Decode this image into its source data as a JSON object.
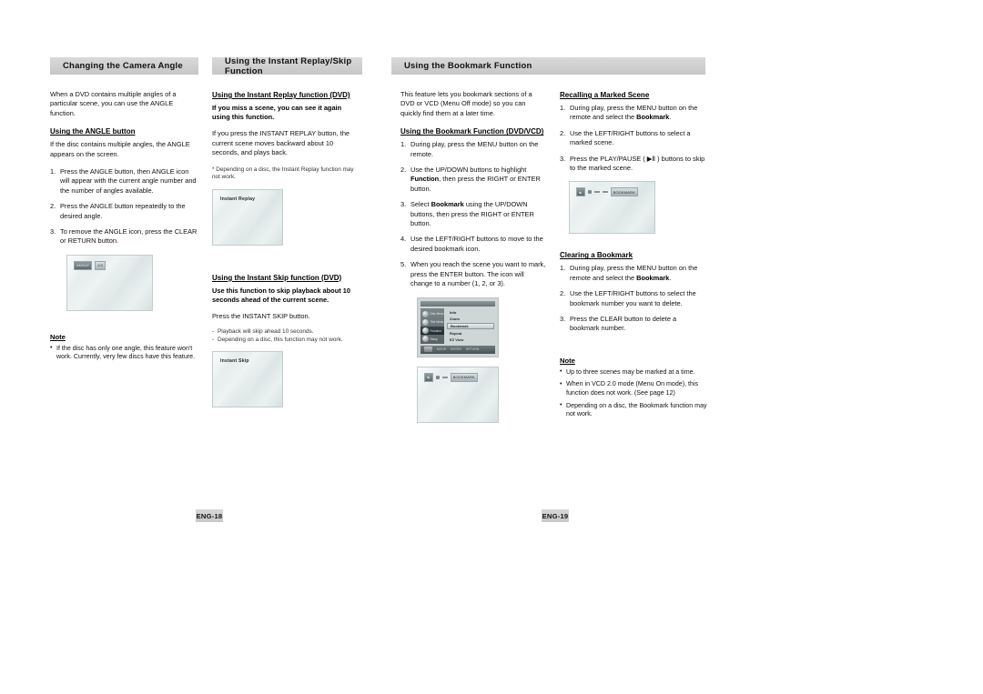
{
  "document": {
    "kind": "dvd-player-user-manual-spread",
    "left_page_number": "ENG-18",
    "right_page_number": "ENG-19"
  },
  "headers": {
    "camera_angle": "Changing the Camera Angle",
    "instant_replay_skip": "Using the Instant Replay/Skip Function",
    "bookmark": "Using the Bookmark Function"
  },
  "column1": {
    "intro": "When a DVD contains multiple angles of a particular scene, you can use the ANGLE function.",
    "sub_angle_button": "Using the ANGLE button",
    "angle_intro": "If the disc contains multiple angles, the ANGLE appears on the screen.",
    "steps": [
      "Press the ANGLE button, then ANGLE icon will appear with the current angle number and the number of angles available.",
      "Press the ANGLE button repeatedly to the desired angle.",
      "To remove the ANGLE icon, press the CLEAR or RETURN button."
    ],
    "screen": {
      "osd_chip_1": "ANGLE",
      "osd_chip_2": "1/3"
    },
    "note_title": "Note",
    "notes": [
      "If the disc has only one angle, this feature won't work. Currently, very few discs have this feature."
    ]
  },
  "column2": {
    "sub_replay": "Using the Instant Replay function (DVD)",
    "replay_lead": "If you miss a scene, you can see it again using this function.",
    "replay_body": "If you press the INSTANT REPLAY button, the current scene moves backward about 10 seconds, and plays back.",
    "replay_fineprint": "* Depending on a disc, the Instant Replay function may not work.",
    "replay_screen_label": "Instant Replay",
    "sub_skip": "Using the Instant Skip function (DVD)",
    "skip_lead": "Use this function to skip playback about 10 seconds ahead of the current scene.",
    "skip_body": "Press the INSTANT SKIP button.",
    "skip_notes": [
      "Playback will skip ahead 10 seconds.",
      "Depending on a disc, this function may not work."
    ],
    "skip_screen_label": "Instant Skip"
  },
  "column3": {
    "intro": "This feature lets you bookmark sections of a DVD or VCD (Menu Off mode) so you can quickly find them at a later time.",
    "sub_bookmark": "Using the Bookmark Function (DVD/VCD)",
    "steps": [
      "During play, press the MENU button on the remote.",
      "Use the UP/DOWN buttons to highlight Function, then press the RIGHT or ENTER button.",
      "Select Bookmark using the UP/DOWN buttons, then press the RIGHT or ENTER button.",
      "Use the LEFT/RIGHT buttons to move to the desired bookmark icon.",
      "When you reach the scene you want to mark, press the ENTER button. The icon will change to a number (1, 2, or 3)."
    ],
    "menu_screen": {
      "left_items": [
        {
          "label": "Disc Menu",
          "selected": false
        },
        {
          "label": "Title Menu",
          "selected": false
        },
        {
          "label": "Function",
          "selected": true
        },
        {
          "label": "Setup",
          "selected": false
        }
      ],
      "right_items": [
        {
          "label": "Info",
          "selected": false
        },
        {
          "label": "Zoom",
          "selected": false
        },
        {
          "label": "Bookmark",
          "selected": true
        },
        {
          "label": "Repeat",
          "selected": false
        },
        {
          "label": "EZ View",
          "selected": false
        }
      ],
      "bottom_hints": [
        "MOVE",
        "ENTER",
        "RETURN"
      ]
    },
    "bookmark_screen": {
      "osd_chip": "BOOKMARK"
    }
  },
  "column4": {
    "sub_recall": "Recalling a Marked Scene",
    "recall_steps": [
      "During play, press the MENU button on the remote and select the Bookmark.",
      "Use the LEFT/RIGHT buttons to select a marked scene.",
      "Press the PLAY/PAUSE ( ▶Ⅱ ) buttons to skip to the marked scene."
    ],
    "recall_screen": {
      "osd_chip": "BOOKMARK"
    },
    "sub_clear": "Clearing a Bookmark",
    "clear_steps": [
      "During play, press the MENU button on the remote and select the Bookmark.",
      "Use the LEFT/RIGHT buttons to select the bookmark number you want to delete.",
      "Press the CLEAR button to delete a bookmark number."
    ],
    "note_title": "Note",
    "notes": [
      "Up to three scenes may be marked at a time.",
      "When in VCD 2.0 mode (Menu On mode), this function does not work. (See page 12)",
      "Depending on a disc, the Bookmark function may not work."
    ]
  }
}
